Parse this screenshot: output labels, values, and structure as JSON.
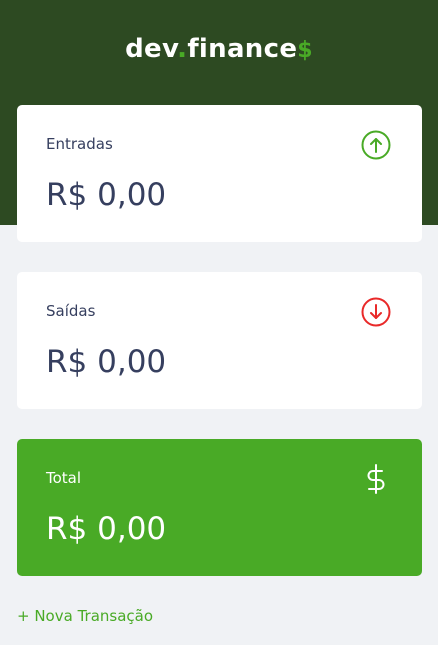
{
  "brand": {
    "name": "dev",
    "dot": ".",
    "suffix": "finance",
    "currency": "$"
  },
  "cards": {
    "income": {
      "label": "Entradas",
      "value": "R$ 0,00",
      "icon": "arrow-up-circle-icon",
      "color": "#49aa26"
    },
    "expense": {
      "label": "Saídas",
      "value": "R$ 0,00",
      "icon": "arrow-down-circle-icon",
      "color": "#e92929"
    },
    "total": {
      "label": "Total",
      "value": "R$ 0,00",
      "icon": "dollar-sign-icon",
      "color": "#49aa26"
    }
  },
  "actions": {
    "new_transaction": "+ Nova Transação"
  },
  "colors": {
    "header": "#2d4a22",
    "accent": "#49aa26",
    "background": "#f0f2f5",
    "text": "#363f5f"
  }
}
